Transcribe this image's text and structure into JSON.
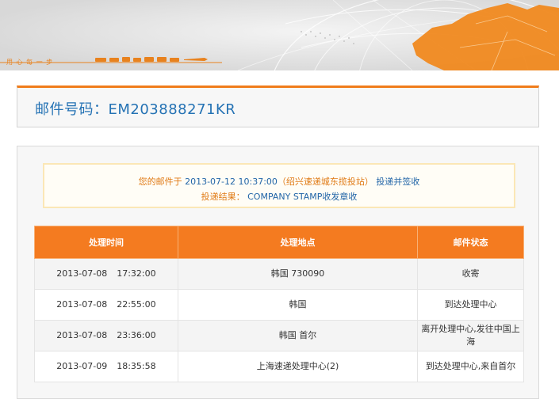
{
  "banner": {
    "slogan": "用 心 每 一 步",
    "colors": {
      "background": "#dcdcdc",
      "accent": "#f07c1b"
    }
  },
  "header": {
    "label": "邮件号码：",
    "number": "EM203888271KR"
  },
  "notice": {
    "prefix": "您的邮件于",
    "datetime": "2013-07-12 10:37:00",
    "office_open": "（",
    "office": "绍兴速递城东揽投站",
    "office_close": "）",
    "action": "投递并签收",
    "result_label": "投递结果：",
    "result": "COMPANY STAMP收发章收"
  },
  "table": {
    "headers": [
      "处理时间",
      "处理地点",
      "邮件状态"
    ],
    "rows": [
      {
        "date": "2013-07-08",
        "time": "17:32:00",
        "location": "韩国 730090",
        "status": "收寄"
      },
      {
        "date": "2013-07-08",
        "time": "22:55:00",
        "location": "韩国",
        "status": "到达处理中心"
      },
      {
        "date": "2013-07-08",
        "time": "23:36:00",
        "location": "韩国 首尔",
        "status": "离开处理中心,发往中国上海"
      },
      {
        "date": "2013-07-09",
        "time": "18:35:58",
        "location": "上海速递处理中心(2)",
        "status": "到达处理中心,来自首尔"
      }
    ]
  }
}
